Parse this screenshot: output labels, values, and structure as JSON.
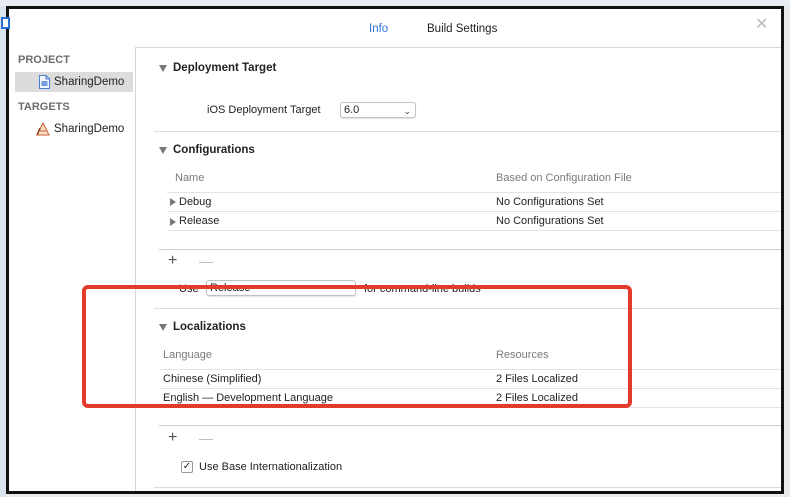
{
  "tabs": [
    {
      "label": "Info",
      "active": true
    },
    {
      "label": "Build Settings",
      "active": false
    }
  ],
  "sidebar": {
    "project_header": "PROJECT",
    "project_item": "SharingDemo",
    "targets_header": "TARGETS",
    "target_item": "SharingDemo"
  },
  "deployment": {
    "title": "Deployment Target",
    "label": "iOS Deployment Target",
    "value": "6.0"
  },
  "configurations": {
    "title": "Configurations",
    "col_name": "Name",
    "col_based": "Based on Configuration File",
    "rows": [
      {
        "name": "Debug",
        "based": "No Configurations Set"
      },
      {
        "name": "Release",
        "based": "No Configurations Set"
      }
    ],
    "use_label": "Use",
    "use_value": "Release",
    "use_suffix": "for command-line builds"
  },
  "localizations": {
    "title": "Localizations",
    "col_language": "Language",
    "col_resources": "Resources",
    "rows": [
      {
        "language": "Chinese (Simplified)",
        "resources": "2 Files Localized"
      },
      {
        "language": "English — Development Language",
        "resources": "2 Files Localized"
      }
    ],
    "base_checkbox_label": "Use Base Internationalization",
    "base_checked": true
  },
  "colors": {
    "accent": "#2f72d6",
    "highlight": "#e43a2c"
  }
}
